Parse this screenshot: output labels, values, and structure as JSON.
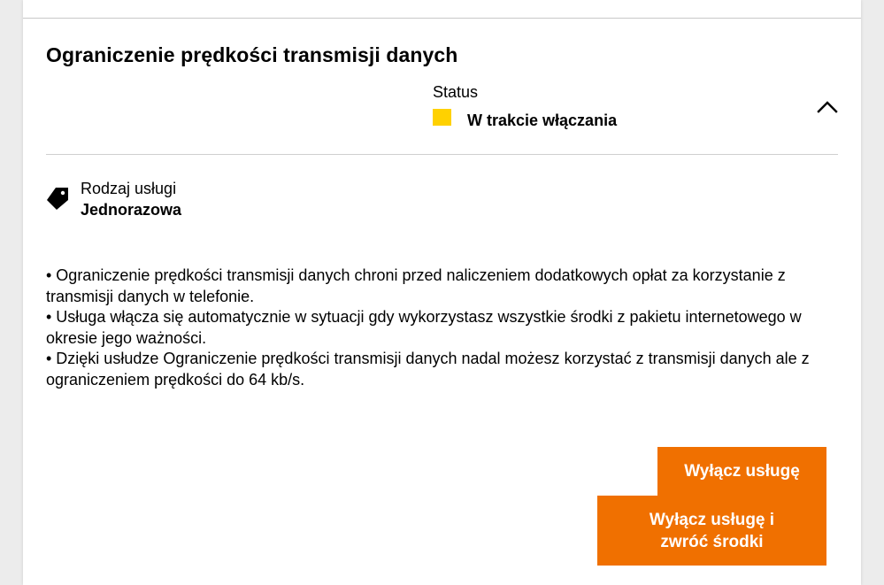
{
  "service": {
    "title": "Ograniczenie prędkości transmisji danych",
    "status_label": "Status",
    "status_value": "W trakcie włączania",
    "status_color": "#ffd100",
    "expanded": true
  },
  "details": {
    "service_type_label": "Rodzaj usługi",
    "service_type_value": "Jednorazowa",
    "icon": "tag-icon"
  },
  "description": {
    "items": [
      "• Ograniczenie prędkości transmisji danych chroni przed naliczeniem dodatkowych opłat za korzystanie z transmisji danych w telefonie.",
      "• Usługa włącza się automatycznie w sytuacji gdy wykorzystasz wszystkie środki z pakietu internetowego w okresie jego ważności.",
      "• Dzięki usłudze Ograniczenie prędkości transmisji danych nadal możesz korzystać z transmisji danych ale z ograniczeniem prędkości do 64 kb/s."
    ]
  },
  "actions": {
    "disable_label": "Wyłącz usługę",
    "disable_refund_label": "Wyłącz usługę i zwróć środki",
    "button_color": "#f07000"
  }
}
